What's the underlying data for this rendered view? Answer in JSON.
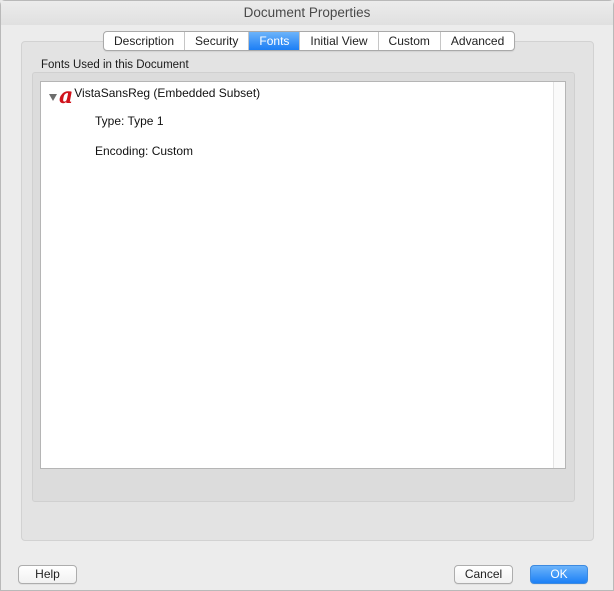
{
  "window": {
    "title": "Document Properties"
  },
  "tabs": [
    {
      "label": "Description",
      "active": false
    },
    {
      "label": "Security",
      "active": false
    },
    {
      "label": "Fonts",
      "active": true
    },
    {
      "label": "Initial View",
      "active": false
    },
    {
      "label": "Custom",
      "active": false
    },
    {
      "label": "Advanced",
      "active": false
    }
  ],
  "fonts_panel": {
    "group_label": "Fonts Used in this Document",
    "fonts": [
      {
        "icon": "type1-font-icon",
        "name": "VistaSansReg (Embedded Subset)",
        "expanded": true,
        "type": "Type: Type 1",
        "encoding": "Encoding: Custom"
      }
    ]
  },
  "buttons": {
    "help": "Help",
    "cancel": "Cancel",
    "ok": "OK"
  },
  "colors": {
    "accent": "#1c7ef5",
    "font_icon": "#d0121b"
  }
}
